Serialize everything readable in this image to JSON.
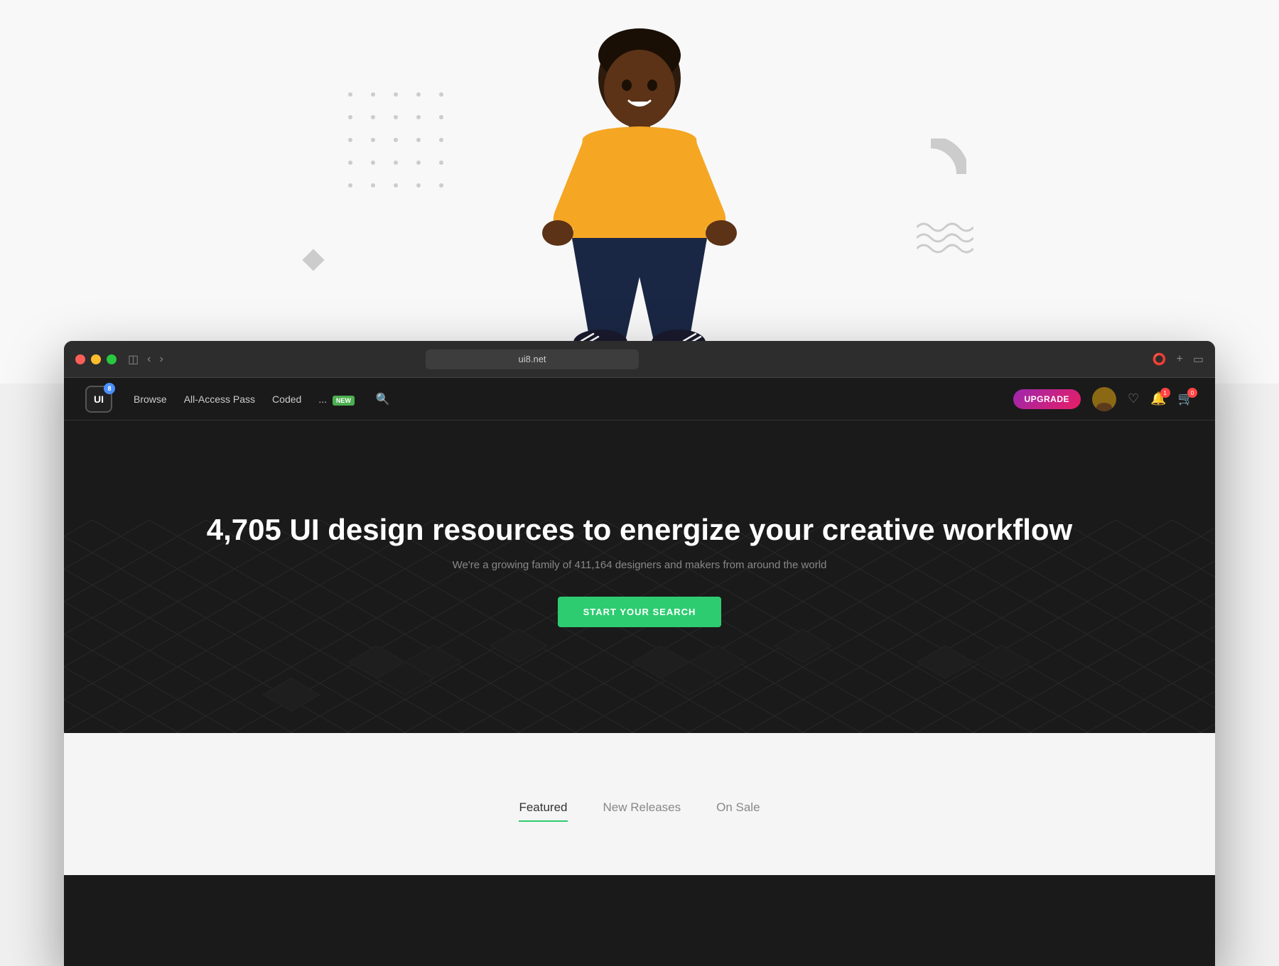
{
  "browser": {
    "address": "ui8.net",
    "traffic_lights": [
      "red",
      "yellow",
      "green"
    ]
  },
  "navbar": {
    "logo_text": "UI",
    "logo_badge": "8",
    "links": [
      {
        "label": "Browse",
        "badge": null
      },
      {
        "label": "All-Access Pass",
        "badge": null
      },
      {
        "label": "Coded",
        "badge": null
      },
      {
        "label": "...",
        "badge": "NEW"
      }
    ],
    "upgrade_label": "UPGRADE",
    "cart_count": "0",
    "notif_count": "1"
  },
  "hero": {
    "title_count": "4,705",
    "title_text": "UI design resources to energize your creative workflow",
    "subtitle": "We're a growing family of 411,164 designers and makers from around the world",
    "cta_button": "START YOUR SEARCH"
  },
  "tabs": {
    "items": [
      {
        "label": "Featured",
        "active": true
      },
      {
        "label": "New Releases",
        "active": false
      },
      {
        "label": "On Sale",
        "active": false
      }
    ]
  }
}
